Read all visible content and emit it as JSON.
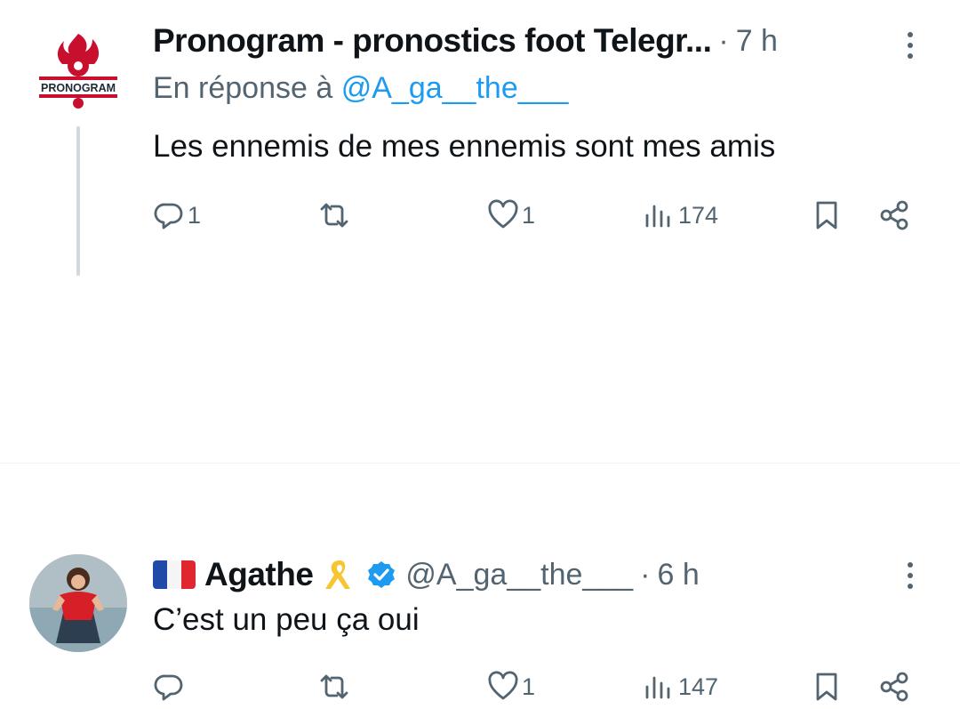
{
  "tweet1": {
    "author": "Pronogram - pronostics foot Telegr...",
    "time": "7 h",
    "reply_prefix": "En réponse à",
    "reply_handle": "@A_ga__the___",
    "text": "Les ennemis de mes ennemis sont mes amis",
    "logo_text": "PRONOGRAM",
    "stats": {
      "replies": "1",
      "likes": "1",
      "views": "174"
    }
  },
  "tweet2": {
    "author": "Agathe",
    "handle": "@A_ga__the___",
    "time": "6 h",
    "text": "C’est un peu ça oui",
    "stats": {
      "likes": "1",
      "views": "147"
    }
  },
  "separator": "·",
  "icons": {
    "reply": "reply-icon",
    "retweet": "retweet-icon",
    "like": "like-icon",
    "views": "views-icon",
    "bookmark": "bookmark-icon",
    "share": "share-icon",
    "more": "more-icon",
    "flag": "france-flag-icon",
    "ribbon": "yellow-ribbon-icon",
    "verified": "verified-badge-icon"
  },
  "colors": {
    "link": "#1d9bf0",
    "secondary": "#536471",
    "text": "#0f1419",
    "logo_red": "#c8102e"
  }
}
